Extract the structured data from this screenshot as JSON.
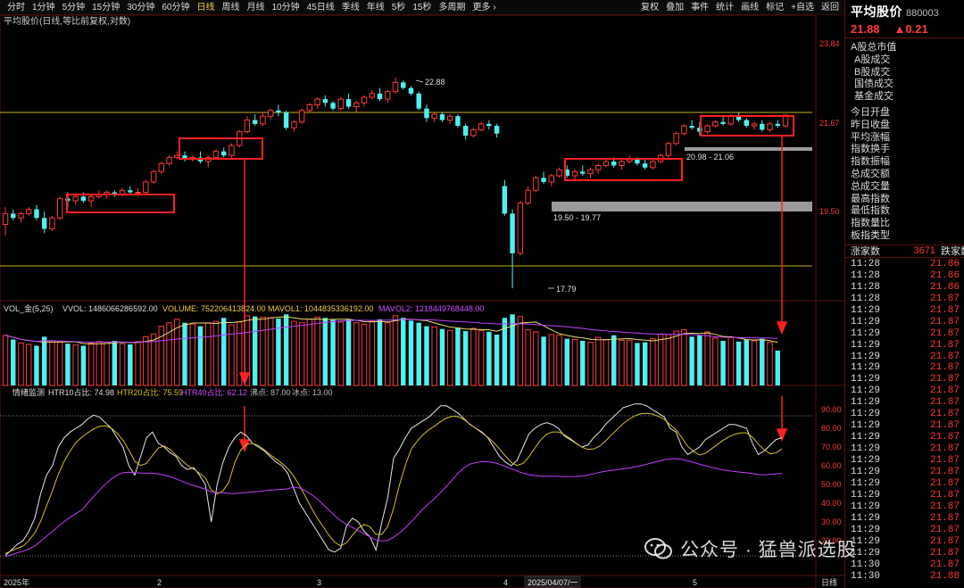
{
  "toolbar": {
    "periods": [
      "分时",
      "1分钟",
      "5分钟",
      "15分钟",
      "30分钟",
      "60分钟",
      "日线",
      "周线",
      "月线",
      "10分钟",
      "45日线",
      "季线",
      "年线",
      "5秒",
      "15秒",
      "多周期",
      "更多 ›"
    ],
    "active_period": "日线",
    "tools": [
      "复权",
      "叠加",
      "事件",
      "统计",
      "画线",
      "标记",
      "+自选",
      "返回"
    ]
  },
  "chart_title": "平均股价(日线,等比前复权,对数)",
  "price_axis": [
    "23.84",
    "21.67",
    "19.50"
  ],
  "annotations": {
    "high": "22.88",
    "low": "17.79",
    "zone_low": "19.50 - 19.77",
    "zone_high": "20.98 - 21.06"
  },
  "volume_legend": {
    "name": "VOL_金(5,25)",
    "vvol": "VVOL: 1486066286592.00",
    "volume": "VOLUME: 752206413824.00",
    "mavol1": "MAVOL1: 1044835336192.00",
    "mavol2": "MAVOL2: 1218449768448.00"
  },
  "sentiment_legend": {
    "name": "情绪监测",
    "htr10": "HTR10占比: 74.98",
    "htr20": "HTR20占比: 75.59",
    "htr40": "HTR40占比: 62.12",
    "boil": "沸点: 87.00",
    "freeze": "冰点: 13.00"
  },
  "sentiment_axis": [
    "90.00",
    "80.00",
    "70.00",
    "60.00",
    "50.00",
    "40.00",
    "30.00",
    "20.00"
  ],
  "date_axis": [
    "2025年",
    "2",
    "3",
    "4",
    "2025/04/07/一",
    "5"
  ],
  "period_label": "日线",
  "sidebar": {
    "name": "平均股价",
    "code": "880003",
    "price": "21.88",
    "change": "▲0.21",
    "fields": [
      "A股总市值",
      "A股成交",
      "B股成交",
      "国债成交",
      "基金成交",
      "今日开盘",
      "昨日收盘",
      "平均涨幅",
      "指数换手",
      "指数振幅",
      "总成交额",
      "总成交量",
      "最高指数",
      "最低指数",
      "指数量比",
      "板指类型"
    ],
    "rise_label": "涨家数",
    "rise_count": "3671",
    "fall_label": "跌家数",
    "ticks": [
      [
        "11:28",
        "21.86"
      ],
      [
        "11:28",
        "21.86"
      ],
      [
        "11:28",
        "21.86"
      ],
      [
        "11:28",
        "21.87"
      ],
      [
        "11:29",
        "21.87"
      ],
      [
        "11:29",
        "21.87"
      ],
      [
        "11:29",
        "21.87"
      ],
      [
        "11:29",
        "21.87"
      ],
      [
        "11:29",
        "21.87"
      ],
      [
        "11:29",
        "21.87"
      ],
      [
        "11:29",
        "21.87"
      ],
      [
        "11:29",
        "21.87"
      ],
      [
        "11:29",
        "21.87"
      ],
      [
        "11:29",
        "21.87"
      ],
      [
        "11:29",
        "21.87"
      ],
      [
        "11:29",
        "21.87"
      ],
      [
        "11:29",
        "21.87"
      ],
      [
        "11:29",
        "21.87"
      ],
      [
        "11:29",
        "21.87"
      ],
      [
        "11:29",
        "21.87"
      ],
      [
        "11:29",
        "21.87"
      ],
      [
        "11:29",
        "21.87"
      ],
      [
        "11:29",
        "21.87"
      ],
      [
        "11:29",
        "21.87"
      ],
      [
        "11:29",
        "21.87"
      ],
      [
        "11:29",
        "21.87"
      ],
      [
        "11:30",
        "21.87"
      ],
      [
        "11:30",
        "21.88"
      ]
    ]
  },
  "watermark": "公众号 · 猛兽派选股",
  "colors": {
    "up": "#ff3b3b",
    "down": "#4ff0f0",
    "yellow": "#d4c020",
    "purple": "#c040ff",
    "white": "#e8e8e8",
    "box": "#ff2020"
  },
  "chart_data": {
    "type": "candlestick",
    "price_scale": "log",
    "ohlc": [
      [
        19.2,
        19.6,
        18.95,
        19.45
      ],
      [
        19.45,
        19.55,
        19.3,
        19.35
      ],
      [
        19.35,
        19.5,
        19.25,
        19.45
      ],
      [
        19.45,
        19.6,
        19.4,
        19.55
      ],
      [
        19.55,
        19.65,
        19.3,
        19.35
      ],
      [
        19.35,
        19.5,
        19.0,
        19.1
      ],
      [
        19.1,
        19.4,
        19.05,
        19.35
      ],
      [
        19.35,
        19.85,
        19.3,
        19.8
      ],
      [
        19.8,
        19.95,
        19.6,
        19.75
      ],
      [
        19.75,
        19.9,
        19.65,
        19.85
      ],
      [
        19.85,
        19.95,
        19.7,
        19.75
      ],
      [
        19.75,
        19.9,
        19.6,
        19.85
      ],
      [
        19.85,
        20.0,
        19.8,
        19.9
      ],
      [
        19.9,
        20.0,
        19.8,
        19.95
      ],
      [
        19.95,
        20.0,
        19.85,
        19.9
      ],
      [
        19.9,
        20.05,
        19.85,
        20.0
      ],
      [
        20.0,
        20.1,
        19.9,
        19.95
      ],
      [
        19.95,
        20.05,
        19.85,
        19.95
      ],
      [
        19.95,
        20.25,
        19.9,
        20.2
      ],
      [
        20.2,
        20.5,
        20.15,
        20.45
      ],
      [
        20.45,
        20.7,
        20.4,
        20.65
      ],
      [
        20.65,
        20.85,
        20.6,
        20.8
      ],
      [
        20.8,
        20.95,
        20.75,
        20.85
      ],
      [
        20.85,
        20.95,
        20.7,
        20.75
      ],
      [
        20.75,
        20.85,
        20.7,
        20.8
      ],
      [
        20.8,
        20.95,
        20.65,
        20.7
      ],
      [
        20.7,
        20.85,
        20.55,
        20.8
      ],
      [
        20.8,
        21.0,
        20.75,
        20.95
      ],
      [
        20.95,
        21.05,
        20.8,
        20.85
      ],
      [
        20.85,
        21.15,
        20.8,
        21.1
      ],
      [
        21.1,
        21.5,
        21.05,
        21.45
      ],
      [
        21.45,
        21.85,
        21.4,
        21.75
      ],
      [
        21.75,
        21.9,
        21.6,
        21.65
      ],
      [
        21.65,
        21.95,
        21.6,
        21.85
      ],
      [
        21.85,
        22.05,
        21.75,
        22.0
      ],
      [
        22.0,
        22.15,
        21.85,
        21.95
      ],
      [
        21.95,
        22.0,
        21.5,
        21.55
      ],
      [
        21.55,
        21.75,
        21.45,
        21.7
      ],
      [
        21.7,
        22.05,
        21.65,
        22.0
      ],
      [
        22.0,
        22.2,
        21.95,
        22.15
      ],
      [
        22.15,
        22.35,
        22.05,
        22.3
      ],
      [
        22.3,
        22.4,
        22.1,
        22.2
      ],
      [
        22.2,
        22.25,
        22.0,
        22.05
      ],
      [
        22.05,
        22.35,
        22.0,
        22.3
      ],
      [
        22.3,
        22.45,
        22.05,
        22.1
      ],
      [
        22.1,
        22.25,
        21.95,
        22.2
      ],
      [
        22.2,
        22.4,
        22.1,
        22.35
      ],
      [
        22.35,
        22.55,
        22.3,
        22.45
      ],
      [
        22.45,
        22.6,
        22.25,
        22.3
      ],
      [
        22.3,
        22.55,
        22.2,
        22.5
      ],
      [
        22.5,
        22.88,
        22.45,
        22.75
      ],
      [
        22.75,
        22.8,
        22.55,
        22.6
      ],
      [
        22.6,
        22.65,
        22.4,
        22.45
      ],
      [
        22.45,
        22.5,
        22.0,
        22.05
      ],
      [
        22.05,
        22.15,
        21.7,
        21.8
      ],
      [
        21.8,
        21.95,
        21.7,
        21.9
      ],
      [
        21.9,
        21.95,
        21.7,
        21.75
      ],
      [
        21.75,
        21.9,
        21.65,
        21.85
      ],
      [
        21.85,
        21.9,
        21.55,
        21.6
      ],
      [
        21.6,
        21.65,
        21.25,
        21.35
      ],
      [
        21.35,
        21.55,
        21.3,
        21.5
      ],
      [
        21.5,
        21.7,
        21.45,
        21.65
      ],
      [
        21.65,
        21.75,
        21.5,
        21.6
      ],
      [
        21.6,
        21.65,
        21.3,
        21.4
      ],
      [
        20.1,
        20.25,
        19.4,
        19.45
      ],
      [
        19.45,
        19.55,
        17.79,
        18.55
      ],
      [
        18.55,
        19.75,
        18.5,
        19.7
      ],
      [
        19.7,
        20.1,
        19.65,
        20.0
      ],
      [
        20.0,
        20.35,
        19.95,
        20.3
      ],
      [
        20.3,
        20.45,
        20.15,
        20.2
      ],
      [
        20.2,
        20.4,
        20.1,
        20.35
      ],
      [
        20.35,
        20.55,
        20.3,
        20.5
      ],
      [
        20.5,
        20.6,
        20.3,
        20.35
      ],
      [
        20.35,
        20.5,
        20.25,
        20.45
      ],
      [
        20.45,
        20.6,
        20.35,
        20.4
      ],
      [
        20.4,
        20.55,
        20.3,
        20.5
      ],
      [
        20.5,
        20.65,
        20.4,
        20.6
      ],
      [
        20.6,
        20.75,
        20.55,
        20.7
      ],
      [
        20.7,
        20.8,
        20.55,
        20.6
      ],
      [
        20.6,
        20.75,
        20.5,
        20.7
      ],
      [
        20.7,
        20.85,
        20.65,
        20.75
      ],
      [
        20.75,
        20.8,
        20.6,
        20.65
      ],
      [
        20.65,
        20.75,
        20.5,
        20.55
      ],
      [
        20.55,
        20.75,
        20.5,
        20.7
      ],
      [
        20.7,
        20.9,
        20.65,
        20.85
      ],
      [
        20.85,
        21.2,
        20.8,
        21.15
      ],
      [
        21.15,
        21.45,
        21.1,
        21.4
      ],
      [
        21.4,
        21.65,
        21.35,
        21.6
      ],
      [
        21.6,
        21.75,
        21.5,
        21.55
      ],
      [
        21.55,
        21.7,
        21.35,
        21.45
      ],
      [
        21.45,
        21.65,
        21.4,
        21.6
      ],
      [
        21.6,
        21.75,
        21.55,
        21.7
      ],
      [
        21.7,
        21.85,
        21.6,
        21.65
      ],
      [
        21.65,
        21.9,
        21.6,
        21.85
      ],
      [
        21.85,
        21.95,
        21.7,
        21.75
      ],
      [
        21.75,
        21.8,
        21.55,
        21.6
      ],
      [
        21.6,
        21.7,
        21.5,
        21.65
      ],
      [
        21.65,
        21.75,
        21.45,
        21.5
      ],
      [
        21.5,
        21.7,
        21.45,
        21.65
      ],
      [
        21.65,
        21.75,
        21.55,
        21.6
      ],
      [
        21.6,
        21.88,
        21.55,
        21.88
      ]
    ],
    "volume": [
      0.72,
      0.66,
      0.61,
      0.59,
      0.57,
      0.7,
      0.64,
      0.62,
      0.6,
      0.58,
      0.57,
      0.61,
      0.63,
      0.62,
      0.64,
      0.6,
      0.59,
      0.63,
      0.7,
      0.74,
      0.85,
      0.9,
      0.95,
      0.9,
      0.88,
      0.85,
      0.9,
      0.92,
      0.97,
      0.87,
      0.91,
      1.0,
      0.99,
      0.98,
      0.97,
      0.96,
      1.02,
      0.92,
      0.9,
      0.95,
      0.98,
      0.97,
      0.94,
      0.91,
      0.95,
      0.9,
      0.88,
      0.92,
      0.95,
      0.9,
      1.0,
      0.97,
      0.93,
      0.9,
      0.85,
      0.84,
      0.81,
      0.79,
      0.83,
      0.78,
      0.82,
      0.79,
      0.77,
      0.73,
      0.97,
      1.02,
      0.99,
      0.8,
      0.77,
      0.7,
      0.73,
      0.72,
      0.67,
      0.66,
      0.64,
      0.62,
      0.69,
      0.66,
      0.72,
      0.65,
      0.65,
      0.61,
      0.62,
      0.67,
      0.74,
      0.73,
      0.78,
      0.8,
      0.7,
      0.72,
      0.77,
      0.68,
      0.64,
      0.69,
      0.63,
      0.66,
      0.64,
      0.67,
      0.62,
      0.5
    ],
    "sentiment": {
      "boil": 87,
      "freeze": 13,
      "htr10": [
        12,
        15,
        18,
        20,
        25,
        32,
        45,
        55,
        60,
        70,
        75,
        78,
        80,
        82,
        85,
        87,
        86,
        83,
        80,
        75,
        70,
        60,
        55,
        65,
        75,
        78,
        72,
        70,
        67,
        65,
        60,
        58,
        59,
        55,
        50,
        30,
        50,
        62,
        70,
        75,
        78,
        76,
        72,
        70,
        68,
        65,
        62,
        60,
        56,
        48,
        40,
        35,
        30,
        25,
        20,
        15,
        14,
        16,
        28,
        32,
        30,
        25,
        22,
        15,
        30,
        43,
        64,
        69,
        75,
        80,
        82,
        84,
        86,
        89,
        92,
        92,
        90,
        88,
        85,
        82,
        80,
        78,
        75,
        70,
        65,
        62,
        60,
        63,
        70,
        77,
        80,
        82,
        83,
        82,
        80,
        76,
        74,
        72,
        70,
        71,
        75,
        78,
        82,
        85,
        88,
        91,
        92,
        93,
        93,
        92,
        90,
        88,
        86,
        80,
        78,
        70,
        66,
        68,
        70,
        74,
        76,
        78,
        80,
        82,
        82,
        81,
        80,
        72,
        66,
        68,
        71,
        74,
        75
      ]
    }
  }
}
